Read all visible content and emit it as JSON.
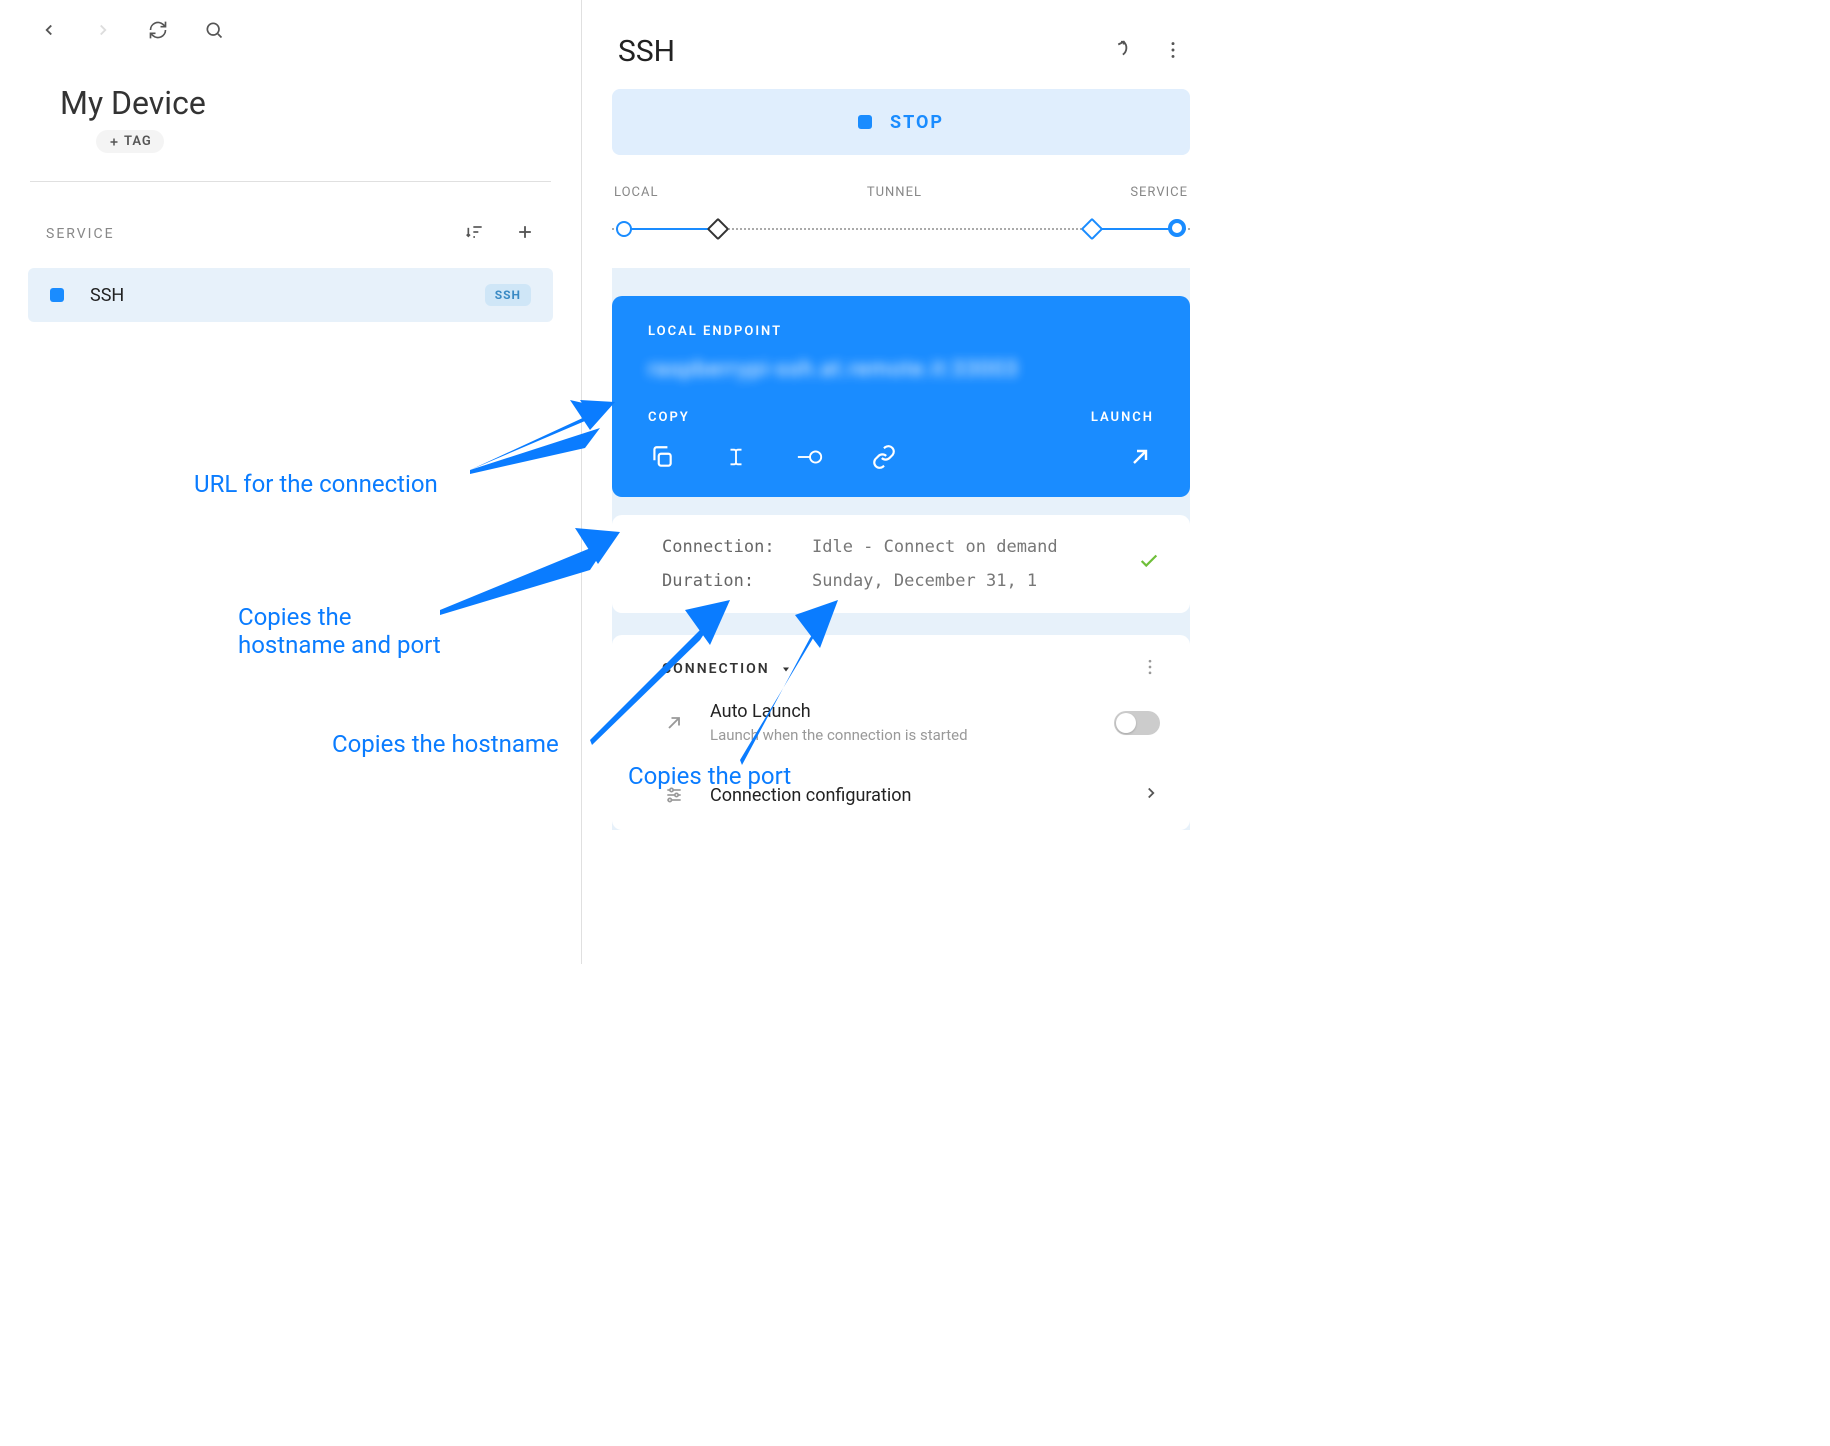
{
  "left": {
    "device_title": "My Device",
    "tag_label": "TAG",
    "section_label": "SERVICE",
    "service_name": "SSH",
    "service_badge": "SSH"
  },
  "right": {
    "title": "SSH",
    "stop_label": "STOP",
    "route": {
      "local": "LOCAL",
      "tunnel": "TUNNEL",
      "service": "SERVICE"
    },
    "endpoint": {
      "label": "LOCAL ENDPOINT",
      "url": "raspberrypi-ssh.at.remote.it:33003",
      "copy_label": "COPY",
      "launch_label": "LAUNCH"
    },
    "info": {
      "connection_label": "Connection:",
      "connection_value": "Idle - Connect on demand",
      "duration_label": "Duration:",
      "duration_value": "Sunday, December 31, 1"
    },
    "connection": {
      "header": "CONNECTION",
      "auto_launch_title": "Auto Launch",
      "auto_launch_sub": "Launch when the connection is started",
      "config_title": "Connection configuration"
    }
  },
  "annotations": {
    "url": "URL for the connection",
    "host_port": "Copies the\nhostname and port",
    "hostname": "Copies the hostname",
    "port": "Copies the port"
  }
}
